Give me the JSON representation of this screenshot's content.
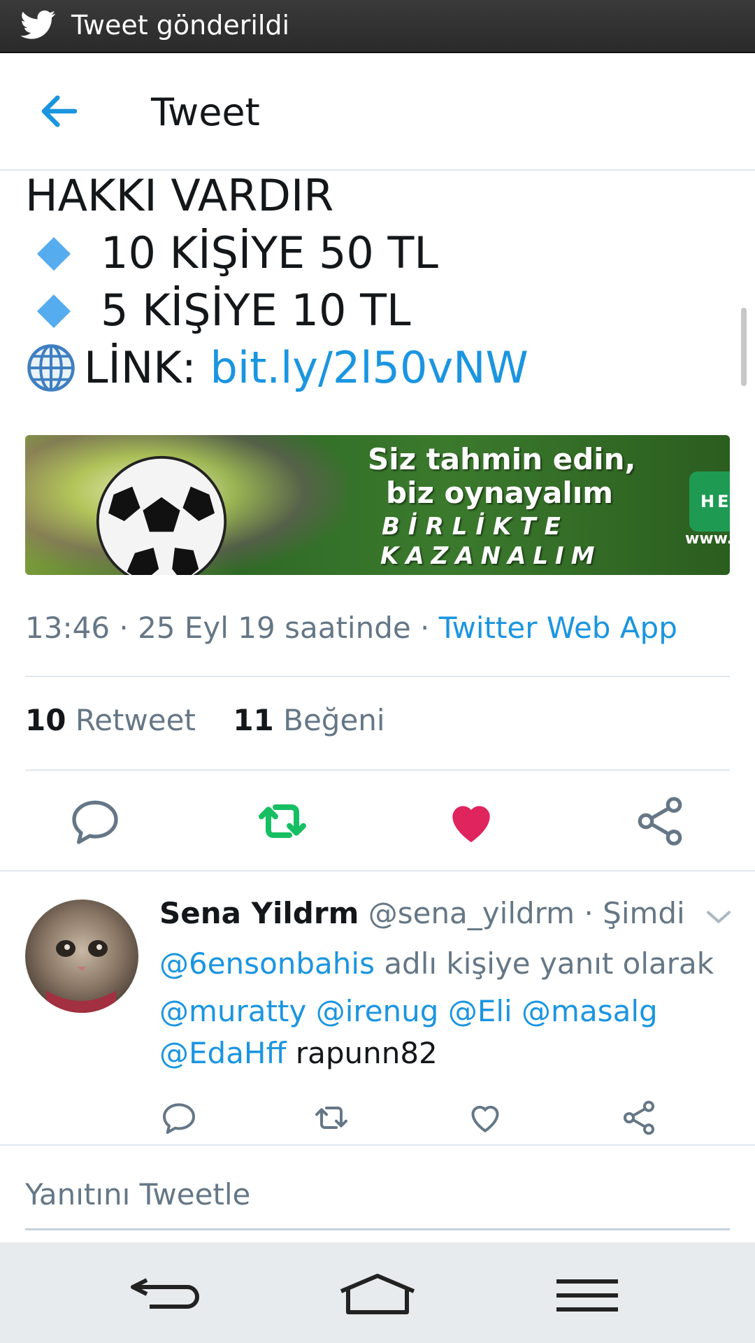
{
  "status_bar": {
    "notification": "Tweet gönderildi",
    "icon": "twitter-bird-icon"
  },
  "header": {
    "title": "Tweet",
    "back_icon": "arrow-left-icon"
  },
  "tweet": {
    "lines": [
      {
        "text": "HAKKI VARDIR"
      },
      {
        "text": "10 KİŞİYE 50 TL",
        "bullet": "blue-diamond-icon"
      },
      {
        "text": "5 KİŞİYE 10 TL",
        "bullet": "blue-diamond-icon"
      }
    ],
    "link_label": "LİNK:",
    "link_url": "bit.ly/2l50vNW",
    "link_icon": "globe-icon",
    "banner": {
      "line1": "Siz tahmin edin,",
      "line2": "biz oynayalım",
      "line3": "BİRLİKTE",
      "line4": "KAZANALIM",
      "button": "HEMEN",
      "url_fragment": "www.e"
    },
    "timestamp": "13:46 · 25 Eyl 19 saatinde · ",
    "source": "Twitter Web App",
    "retweets_count": "10",
    "retweets_label": "Retweet",
    "likes_count": "11",
    "likes_label": "Beğeni",
    "actions": [
      "reply-icon",
      "retweet-icon",
      "like-icon",
      "share-icon"
    ],
    "colors": {
      "retweet_active": "#17bf63",
      "like_active": "#e0245e",
      "link": "#1b95e0"
    }
  },
  "reply": {
    "name": "Sena Yildrm",
    "handle": "@sena_yildrm",
    "time": "Şimdi",
    "context_mention": "@6ensonbahis",
    "context_text": "adlı kişiye yanıt olarak",
    "mentions_line1": [
      "@muratty",
      "@irenug",
      "@Eli",
      "@masalg"
    ],
    "mention_line2": "@EdaHff",
    "text_after": "rapunn82",
    "actions": [
      "reply-icon",
      "retweet-icon",
      "like-icon",
      "share-icon"
    ]
  },
  "composer": {
    "placeholder": "Yanıtını Tweetle"
  },
  "navbar": {
    "buttons": [
      "back-nav-icon",
      "home-nav-icon",
      "menu-nav-icon"
    ]
  }
}
